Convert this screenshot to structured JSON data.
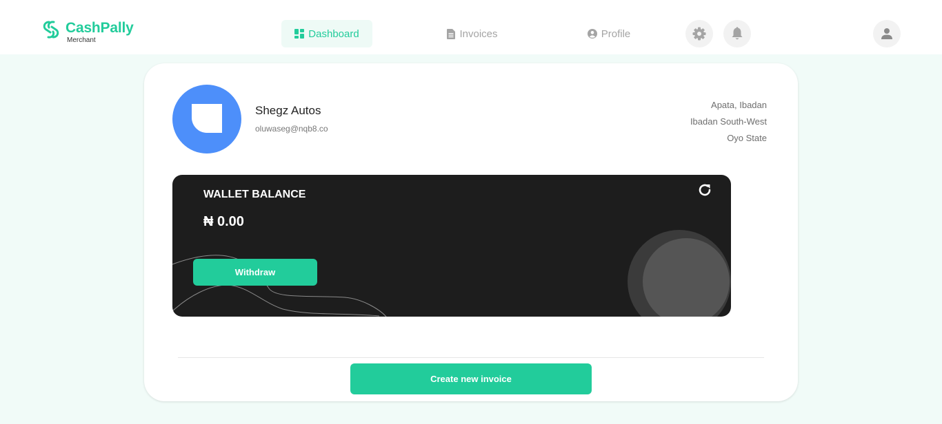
{
  "brand": {
    "name": "CashPally",
    "subtitle": "Merchant",
    "color": "#22cc9b"
  },
  "nav": {
    "dashboard": {
      "label": "Dashboard",
      "icon": "grid-icon",
      "active": true
    },
    "invoices": {
      "label": "Invoices",
      "icon": "document-icon"
    },
    "profile": {
      "label": "Profile",
      "icon": "user-circle-icon"
    }
  },
  "header_icons": [
    "gear-icon",
    "bell-icon",
    "user-icon"
  ],
  "merchant": {
    "name": "Shegz Autos",
    "email": "oluwaseg@nqb8.co",
    "address": [
      "Apata, Ibadan",
      "Ibadan South-West",
      "Oyo State"
    ]
  },
  "wallet": {
    "label": "WALLET BALANCE",
    "balance": "₦ 0.00",
    "withdraw_label": "Withdraw",
    "refresh_icon": "refresh-icon"
  },
  "actions": {
    "create_invoice_label": "Create new invoice"
  },
  "colors": {
    "accent": "#22cc9b",
    "avatar": "#4d8ffa",
    "wallet_bg": "#1d1d1d",
    "page_bg": "#f1fbf8"
  }
}
